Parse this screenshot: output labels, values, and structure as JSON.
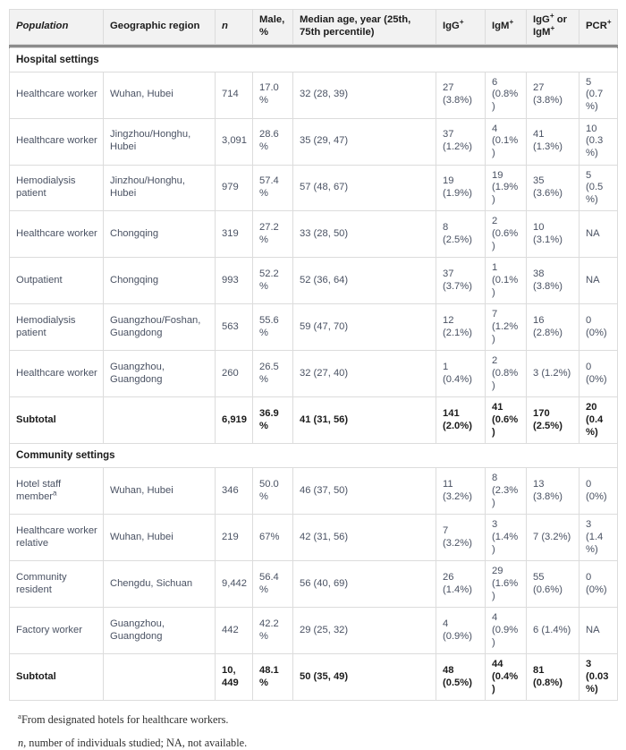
{
  "table": {
    "columns": [
      {
        "label": "Population",
        "key": "population"
      },
      {
        "label": "Geographic region",
        "key": "region"
      },
      {
        "label": "n",
        "key": "n",
        "italic": true
      },
      {
        "label": "Male, %",
        "key": "male"
      },
      {
        "label": "Median age, year (25th, 75th percentile)",
        "key": "age"
      },
      {
        "label": "IgG+",
        "key": "igg"
      },
      {
        "label": "IgM+",
        "key": "igm"
      },
      {
        "label": "IgG+ or IgM+",
        "key": "both"
      },
      {
        "label": "PCR+",
        "key": "pcr"
      }
    ],
    "sections": [
      {
        "title": "Hospital settings",
        "rows": [
          {
            "population": "Healthcare worker",
            "region": "Wuhan, Hubei",
            "n": "714",
            "male": "17.0%",
            "age": "32 (28, 39)",
            "igg": "27 (3.8%)",
            "igm": "6 (0.8%)",
            "both": "27 (3.8%)",
            "pcr": "5 (0.7%)"
          },
          {
            "population": "Healthcare worker",
            "region": "Jingzhou/Honghu, Hubei",
            "n": "3,091",
            "male": "28.6%",
            "age": "35 (29, 47)",
            "igg": "37 (1.2%)",
            "igm": "4 (0.1%)",
            "both": "41 (1.3%)",
            "pcr": "10 (0.3%)"
          },
          {
            "population": "Hemodialysis patient",
            "region": "Jinzhou/Honghu, Hubei",
            "n": "979",
            "male": "57.4%",
            "age": "57 (48, 67)",
            "igg": "19 (1.9%)",
            "igm": "19 (1.9%)",
            "both": "35 (3.6%)",
            "pcr": "5 (0.5%)"
          },
          {
            "population": "Healthcare worker",
            "region": "Chongqing",
            "n": "319",
            "male": "27.2%",
            "age": "33 (28, 50)",
            "igg": "8 (2.5%)",
            "igm": "2 (0.6%)",
            "both": "10 (3.1%)",
            "pcr": "NA"
          },
          {
            "population": "Outpatient",
            "region": "Chongqing",
            "n": "993",
            "male": "52.2%",
            "age": "52 (36, 64)",
            "igg": "37 (3.7%)",
            "igm": "1 (0.1%)",
            "both": "38 (3.8%)",
            "pcr": "NA"
          },
          {
            "population": "Hemodialysis patient",
            "region": "Guangzhou/Foshan, Guangdong",
            "n": "563",
            "male": "55.6%",
            "age": "59 (47, 70)",
            "igg": "12 (2.1%)",
            "igm": "7 (1.2%)",
            "both": "16 (2.8%)",
            "pcr": "0 (0%)"
          },
          {
            "population": "Healthcare worker",
            "region": "Guangzhou, Guangdong",
            "n": "260",
            "male": "26.5%",
            "age": "32 (27, 40)",
            "igg": "1 (0.4%)",
            "igm": "2 (0.8%)",
            "both": "3 (1.2%)",
            "pcr": "0 (0%)"
          }
        ],
        "subtotal": {
          "population": "Subtotal",
          "region": "",
          "n": "6,919",
          "male": "36.9%",
          "age": "41 (31, 56)",
          "igg": "141 (2.0%)",
          "igm": "41 (0.6%)",
          "both": "170 (2.5%)",
          "pcr": "20 (0.4%)"
        }
      },
      {
        "title": "Community settings",
        "rows": [
          {
            "population": "Hotel staff member",
            "population_sup": "a",
            "region": "Wuhan, Hubei",
            "n": "346",
            "male": "50.0%",
            "age": "46 (37, 50)",
            "igg": "11 (3.2%)",
            "igm": "8 (2.3%)",
            "both": "13 (3.8%)",
            "pcr": "0 (0%)"
          },
          {
            "population": "Healthcare worker relative",
            "region": "Wuhan, Hubei",
            "n": "219",
            "male": "67%",
            "age": "42 (31, 56)",
            "igg": "7 (3.2%)",
            "igm": "3 (1.4%)",
            "both": "7 (3.2%)",
            "pcr": "3 (1.4%)"
          },
          {
            "population": "Community resident",
            "region": "Chengdu, Sichuan",
            "n": "9,442",
            "male": "56.4%",
            "age": "56 (40, 69)",
            "igg": "26 (1.4%)",
            "igm": "29 (1.6%)",
            "both": "55 (0.6%)",
            "pcr": "0 (0%)"
          },
          {
            "population": "Factory worker",
            "region": "Guangzhou, Guangdong",
            "n": "442",
            "male": "42.2%",
            "age": "29 (25, 32)",
            "igg": "4 (0.9%)",
            "igm": "4 (0.9%)",
            "both": "6 (1.4%)",
            "pcr": "NA"
          }
        ],
        "subtotal": {
          "population": "Subtotal",
          "region": "",
          "n": "10, 449",
          "male": "48.1%",
          "age": "50 (35, 49)",
          "igg": "48 (0.5%)",
          "igm": "44 (0.4%)",
          "both": "81 (0.8%)",
          "pcr": "3 (0.03%)"
        }
      }
    ]
  },
  "footnotes": [
    {
      "marker": "a",
      "text": "From designated hotels for healthcare workers."
    },
    {
      "marker": "",
      "italic_lead": "n",
      "text": ", number of individuals studied; NA, not available."
    }
  ],
  "colors": {
    "header_bg": "#f2f2f2",
    "header_rule": "#8c8c8c",
    "border": "#dcdcdc",
    "body_text": "#4a5263",
    "strong_text": "#1c1c1c"
  }
}
